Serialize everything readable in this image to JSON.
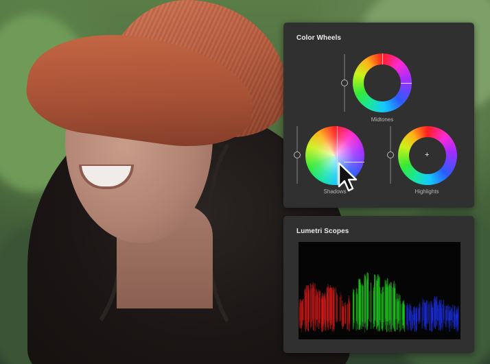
{
  "color_wheels": {
    "title": "Color Wheels",
    "wheels": {
      "midtones": {
        "label": "Midtones"
      },
      "shadows": {
        "label": "Shadows"
      },
      "highlights": {
        "label": "Highlights"
      }
    }
  },
  "lumetri_scopes": {
    "title": "Lumetri Scopes",
    "parade_colors": [
      "#d11a1a",
      "#1ec81e",
      "#1a2fe0"
    ]
  },
  "icons": {
    "cursor": "arrow-pointer-icon",
    "highlights_center": "plus-icon"
  }
}
